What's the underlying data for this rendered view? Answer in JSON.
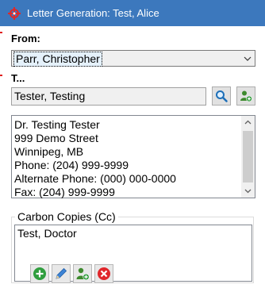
{
  "window": {
    "title": "Letter Generation: Test, Alice",
    "app_icon": "crosshair-icon",
    "title_bar_color": "#3c78bd"
  },
  "from": {
    "label": "From:",
    "selected": "Parr, Christopher"
  },
  "to": {
    "label": "T...",
    "recipient": "Tester, Testing",
    "search_icon": "magnifier-icon",
    "add_contact_icon": "add-person-icon"
  },
  "address": {
    "lines": [
      "Dr. Testing Tester",
      "999 Demo Street",
      "Winnipeg, MB",
      "Phone: (204) 999-9999",
      "Alternate Phone: (000) 000-0000",
      "Fax: (204) 999-9999"
    ]
  },
  "carbon_copies": {
    "legend": "Carbon Copies (Cc)",
    "items": [
      "Test, Doctor"
    ],
    "toolbar": {
      "add_icon": "plus-circle-icon",
      "edit_icon": "pencil-icon",
      "add_person_icon": "add-person-icon",
      "remove_icon": "x-circle-icon"
    }
  }
}
